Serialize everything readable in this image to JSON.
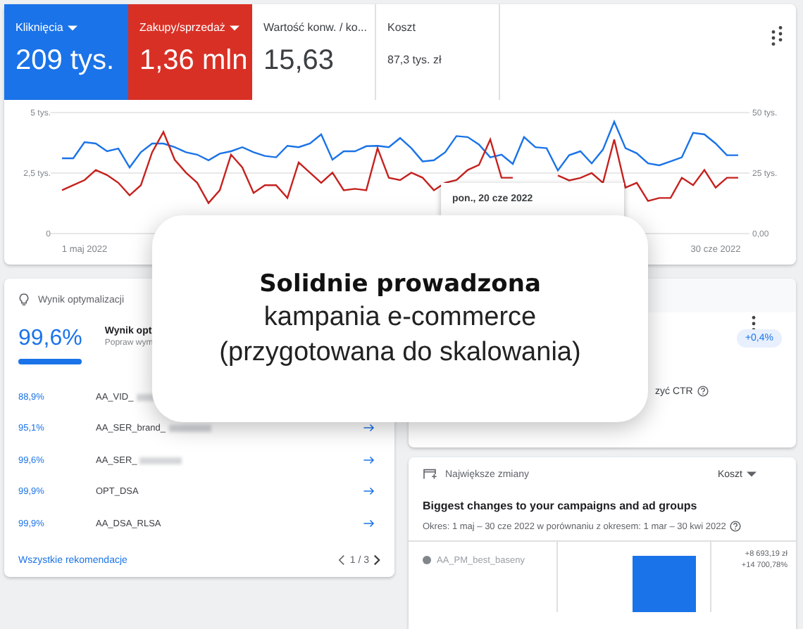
{
  "metrics": [
    {
      "label": "Kliknięcia",
      "value": "209 tys.",
      "kind": "blue",
      "dropdown": true
    },
    {
      "label": "Zakupy/sprzedaż",
      "value": "1,36 mln",
      "kind": "red",
      "dropdown": true
    },
    {
      "label": "Wartość konw. / ko...",
      "value": "15,63",
      "kind": "plain",
      "dropdown": false
    },
    {
      "label": "Koszt",
      "value": "87,3 tys. zł",
      "kind": "small",
      "dropdown": false
    }
  ],
  "chart": {
    "chart_data": {
      "type": "line",
      "categories": [
        null,
        null,
        "1 maj 2022",
        null,
        null,
        null,
        null,
        null,
        null,
        null,
        null,
        null,
        null,
        null,
        null,
        null,
        null,
        null,
        null,
        null,
        null,
        null,
        null,
        null,
        null,
        null,
        null,
        null,
        null,
        null,
        null,
        null,
        null,
        null,
        null,
        null,
        null,
        null,
        null,
        null,
        null,
        null,
        null,
        null,
        null,
        null,
        null,
        null,
        null,
        null,
        null,
        null,
        null,
        null,
        null,
        null,
        null,
        null,
        "30 cze 2022",
        null,
        null
      ],
      "ylim": [
        0,
        5
      ],
      "yticks": [
        {
          "value": 0,
          "label": "0"
        },
        {
          "value": 2.5,
          "label": "2,5 tys."
        },
        {
          "value": 5,
          "label": "5 tys."
        }
      ],
      "y2lim": [
        0,
        50
      ],
      "y2ticks": [
        {
          "value": 0,
          "label": "0,00"
        },
        {
          "value": 25,
          "label": "25 tys."
        },
        {
          "value": 50,
          "label": "50 tys."
        }
      ],
      "series": [
        {
          "color": "#1a73e8",
          "values": [
            3.11,
            3.11,
            3.78,
            3.72,
            3.4,
            3.51,
            2.73,
            3.36,
            3.72,
            3.72,
            3.57,
            3.36,
            3.26,
            3.03,
            3.3,
            3.4,
            3.57,
            3.36,
            3.21,
            3.15,
            3.63,
            3.57,
            3.72,
            4.1,
            3.05,
            3.4,
            3.4,
            3.61,
            3.63,
            3.57,
            3.95,
            3.53,
            2.98,
            3.03,
            3.36,
            4.03,
            3.99,
            3.68,
            3.15,
            3.26,
            2.88,
            3.99,
            3.57,
            3.53,
            2.61,
            3.24,
            3.4,
            2.9,
            3.47,
            4.62,
            3.53,
            3.32,
            2.9,
            2.82,
            2.98,
            3.15,
            4.16,
            4.1,
            3.72,
            3.24,
            3.24
          ]
        },
        {
          "color": "#c5221f",
          "axis": "y2",
          "values": [
            17.9,
            20,
            22.1,
            26.3,
            24.2,
            21,
            15.8,
            20,
            33.6,
            42,
            30.5,
            25.2,
            21,
            12.6,
            17.9,
            32.6,
            27.3,
            16.8,
            20,
            20,
            14.7,
            29.4,
            25.2,
            21,
            25.2,
            17.9,
            18.5,
            17.9,
            35.3,
            23.1,
            22.1,
            25.2,
            23.1,
            17.9,
            21,
            22.1,
            26.3,
            28.4,
            38.9,
            23.1,
            23.1,
            null,
            null,
            null,
            24,
            22,
            23,
            25,
            21,
            38.9,
            19,
            21,
            13.5,
            14.7,
            14.7,
            23.1,
            20,
            26.3,
            19,
            23.1,
            23.1
          ]
        }
      ]
    },
    "tooltip": "pon., 20 cze 2022"
  },
  "optimization": {
    "header": "Wynik optymalizacji",
    "score": "99,6%",
    "level": 0.996,
    "title": "Wynik opt",
    "subtitle": "Popraw wym",
    "rows": [
      {
        "percent": "88,9%",
        "name": "AA_VID_",
        "blurred": true,
        "arrow": false
      },
      {
        "percent": "95,1%",
        "name": "AA_SER_brand_",
        "blurred": true,
        "arrow": true
      },
      {
        "percent": "99,6%",
        "name": "AA_SER_",
        "blurred": true,
        "arrow": true
      },
      {
        "percent": "99,9%",
        "name": "OPT_DSA",
        "blurred": false,
        "arrow": true
      },
      {
        "percent": "99,9%",
        "name": "AA_DSA_RLSA",
        "blurred": false,
        "arrow": true
      }
    ],
    "link": "Wszystkie rekomendacje",
    "pager": "1 / 3"
  },
  "ctr_card": {
    "badge": "+0,4%",
    "text": "zyć CTR"
  },
  "changes": {
    "header": "Największe zmiany",
    "sort": "Koszt",
    "title": "Biggest changes to your campaigns and ad groups",
    "period": "Okres: 1 maj – 30 cze 2022 w porównaniu z okresem: 1 mar – 30 kwi 2022",
    "rows": [
      {
        "name": "AA_PM_best_baseny",
        "amount": "+8 693,19 zł",
        "change": "+14 700,78%"
      }
    ]
  },
  "overlay": {
    "heading": "Solidnie prowadzona",
    "lines": [
      "kampania e-commerce",
      "(przygotowana do skalowania)"
    ]
  }
}
